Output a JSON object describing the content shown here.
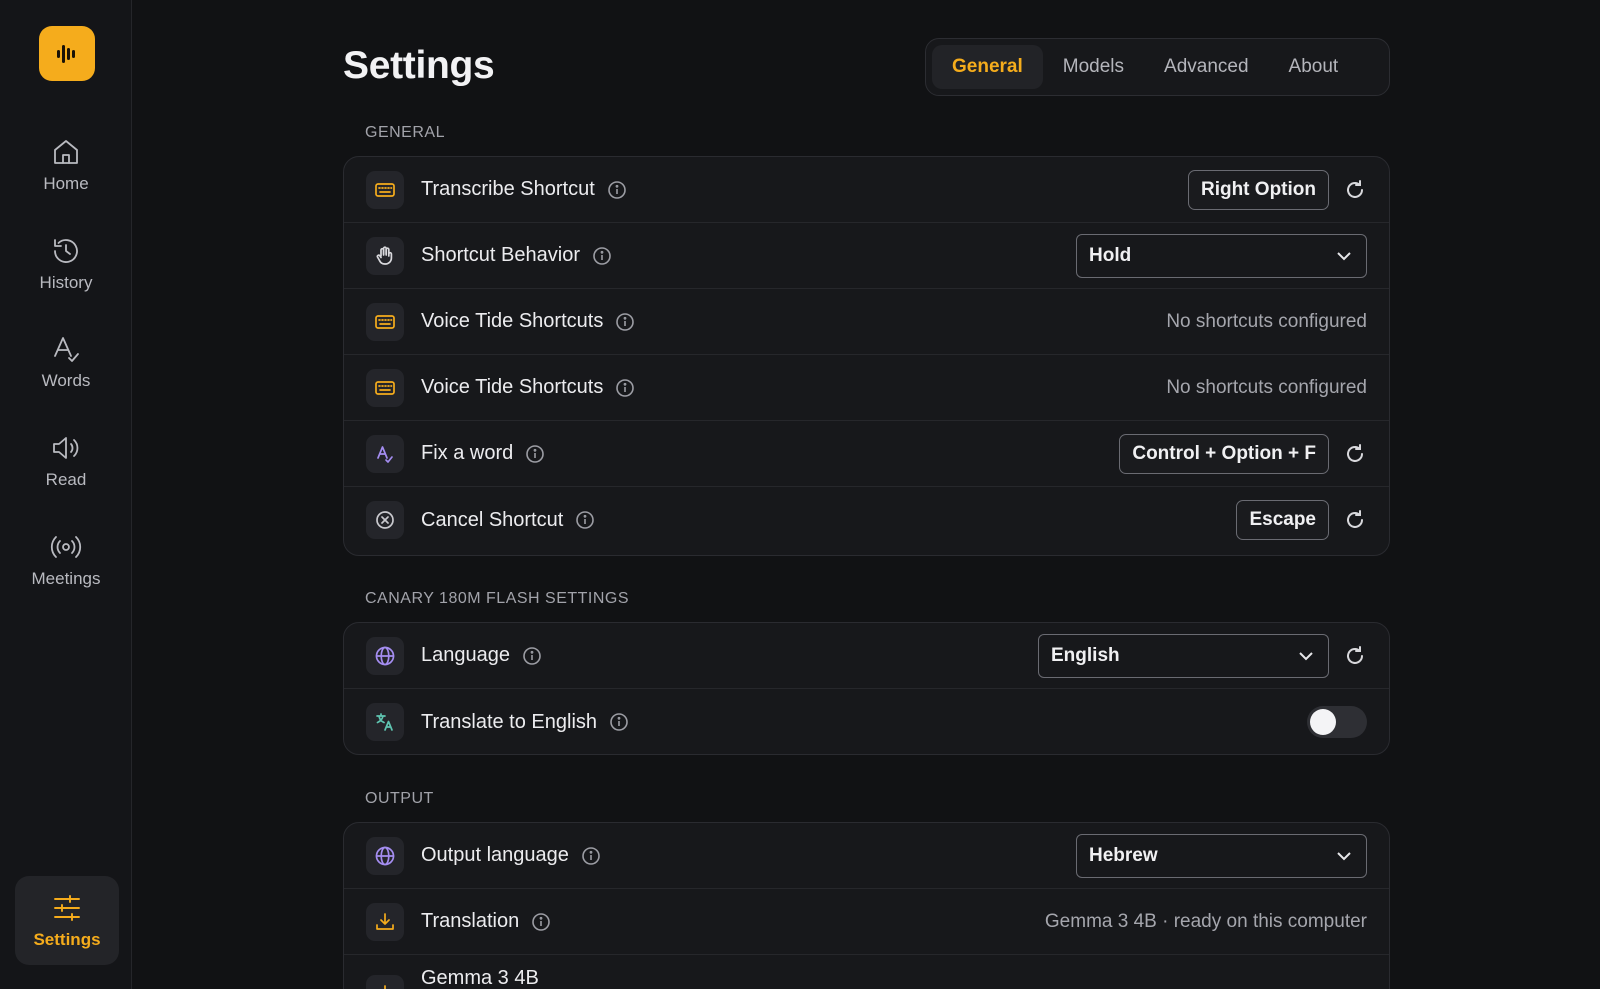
{
  "sidebar": {
    "items": [
      {
        "label": "Home",
        "icon": "home-icon"
      },
      {
        "label": "History",
        "icon": "history-icon"
      },
      {
        "label": "Words",
        "icon": "words-icon"
      },
      {
        "label": "Read",
        "icon": "speaker-icon"
      },
      {
        "label": "Meetings",
        "icon": "broadcast-icon"
      }
    ],
    "active": {
      "label": "Settings",
      "icon": "sliders-icon"
    }
  },
  "header": {
    "title": "Settings",
    "tabs": [
      {
        "label": "General",
        "active": true
      },
      {
        "label": "Models",
        "active": false
      },
      {
        "label": "Advanced",
        "active": false
      },
      {
        "label": "About",
        "active": false
      }
    ]
  },
  "general": {
    "section_label": "GENERAL",
    "rows": [
      {
        "label": "Transcribe Shortcut",
        "value": "Right Option",
        "icon": "keyboard-icon"
      },
      {
        "label": "Shortcut Behavior",
        "value": "Hold",
        "icon": "hand-icon"
      },
      {
        "label": "Voice Tide Shortcuts",
        "value": "No shortcuts configured",
        "icon": "keyboard-icon"
      },
      {
        "label": "Voice Tide Shortcuts",
        "value": "No shortcuts configured",
        "icon": "keyboard-icon"
      },
      {
        "label": "Fix a word",
        "value": "Control + Option + F",
        "icon": "spellcheck-icon"
      },
      {
        "label": "Cancel Shortcut",
        "value": "Escape",
        "icon": "cancel-circle-icon"
      }
    ]
  },
  "canary": {
    "section_label": "CANARY 180M FLASH SETTINGS",
    "rows": [
      {
        "label": "Language",
        "value": "English",
        "icon": "globe-icon"
      },
      {
        "label": "Translate to English",
        "toggle_on": false,
        "icon": "translate-icon"
      }
    ]
  },
  "output": {
    "section_label": "OUTPUT",
    "rows": [
      {
        "label": "Output language",
        "value": "Hebrew",
        "icon": "globe-icon"
      },
      {
        "label": "Translation",
        "value": "Gemma 3 4B · ready on this computer",
        "icon": "download-icon"
      },
      {
        "label": "Gemma 3 4B",
        "icon": "download-icon"
      }
    ]
  },
  "colors": {
    "accent": "#f5ac1c",
    "background": "#111214",
    "card": "#17181b",
    "purple_icon": "#a48df0",
    "teal_icon": "#5fc5b1"
  }
}
